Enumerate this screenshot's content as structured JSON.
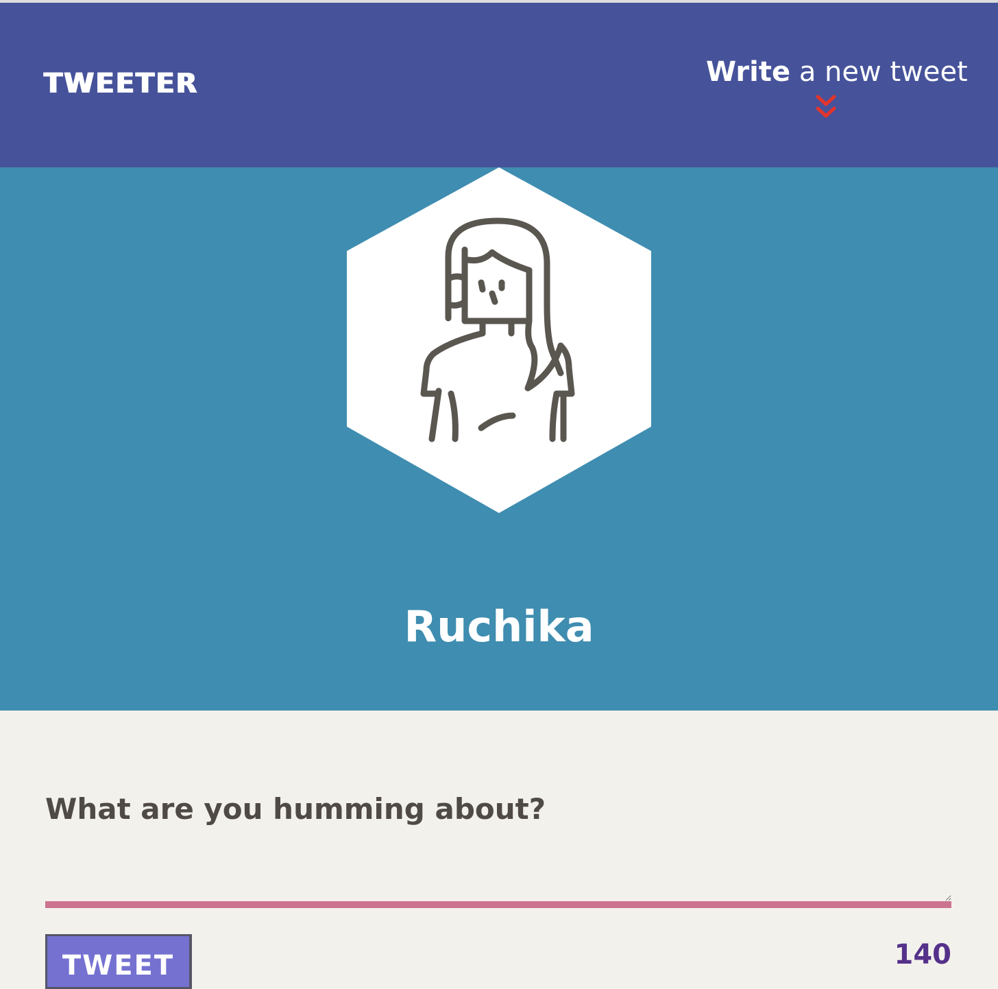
{
  "nav": {
    "brand": "TWEETER",
    "compose_strong": "Write",
    "compose_rest": " a new tweet"
  },
  "profile": {
    "username": "Ruchika"
  },
  "composer": {
    "prompt": "What are you humming about?",
    "input_value": "",
    "button_label": "TWEET",
    "char_count": "140"
  },
  "icons": {
    "compose": "double-chevron-down-icon",
    "avatar": "woman-line-avatar"
  },
  "colors": {
    "navbar": "#46539a",
    "profile": "#3f8db0",
    "background": "#f3f1ec",
    "accent_line": "#cd7392",
    "chevron": "#e2342c",
    "button": "#7471d1",
    "counter": "#55318a"
  }
}
